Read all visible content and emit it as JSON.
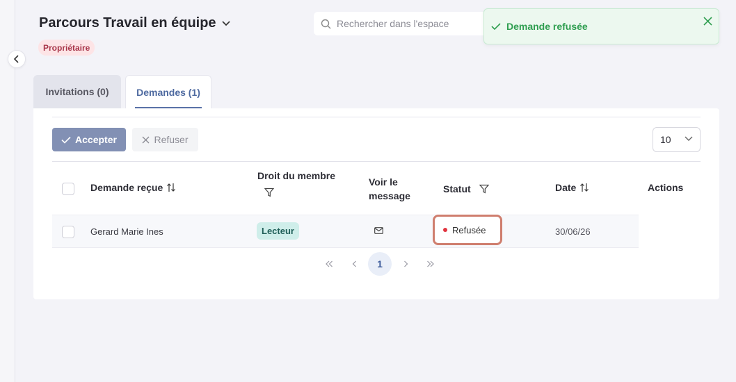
{
  "header": {
    "title": "Parcours Travail en équipe",
    "role_badge": "Propriétaire"
  },
  "search": {
    "placeholder": "Rechercher dans l'espace"
  },
  "toast": {
    "message": "Demande refusée",
    "color": "#2f9e50"
  },
  "tabs": [
    {
      "label": "Invitations (0)",
      "active": false
    },
    {
      "label": "Demandes (1)",
      "active": true
    }
  ],
  "toolbar": {
    "accept_label": "Accepter",
    "refuse_label": "Refuser",
    "page_size": "10"
  },
  "table": {
    "headers": {
      "request": "Demande reçue",
      "member_right_line1": "Droit du membre",
      "message_line1": "Voir le",
      "message_line2": "message",
      "status": "Statut",
      "date": "Date",
      "actions": "Actions"
    },
    "rows": [
      {
        "name": "Gerard Marie Ines",
        "role": "Lecteur",
        "message_icon": "mail-icon",
        "status": "Refusée",
        "date": "30/06/26"
      }
    ]
  },
  "pagination": {
    "current": "1"
  },
  "colors": {
    "accent": "#5a72a8",
    "accept_button": "#8290b4",
    "status_refused_dot": "#e1343f",
    "role_badge_bg": "#fde4e6",
    "role_pill_bg": "#cfeeea"
  }
}
